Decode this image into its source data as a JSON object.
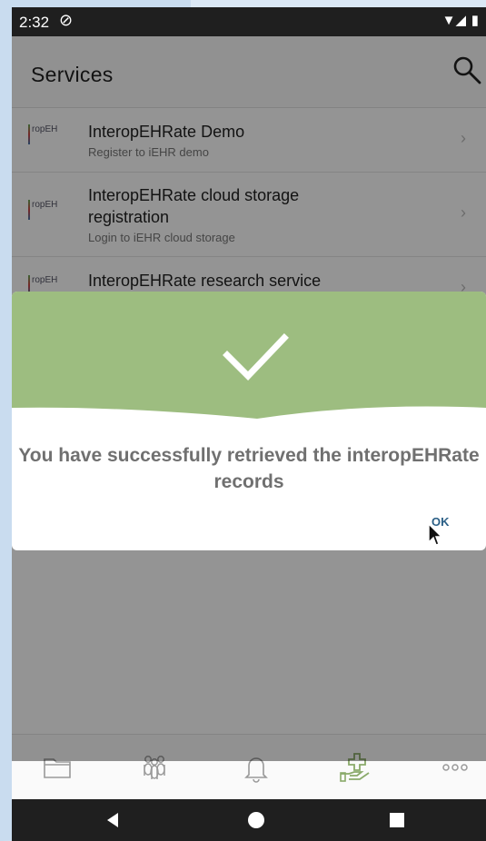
{
  "status_bar": {
    "time": "2:32"
  },
  "app_bar": {
    "title": "Services"
  },
  "services": [
    {
      "name": "InteropEHRate Demo",
      "description": "Register to iEHR demo",
      "logo_text": "ropEH"
    },
    {
      "name": "InteropEHRate cloud storage registration",
      "description": "Login to iEHR cloud storage",
      "logo_text": "ropEH"
    },
    {
      "name": "InteropEHRate research service",
      "description": "",
      "logo_text": "ropEH"
    }
  ],
  "dialog": {
    "message": "You have successfully retrieved the interopEHRate records",
    "ok_label": "OK",
    "banner_color": "#9dbd80"
  },
  "bottom_nav": [
    "folder-icon",
    "people-icon",
    "bell-icon",
    "medical-hand-icon",
    "more-icon"
  ],
  "colors": {
    "accent_green": "#8aaa6a",
    "ok_blue": "#2b5f86"
  }
}
